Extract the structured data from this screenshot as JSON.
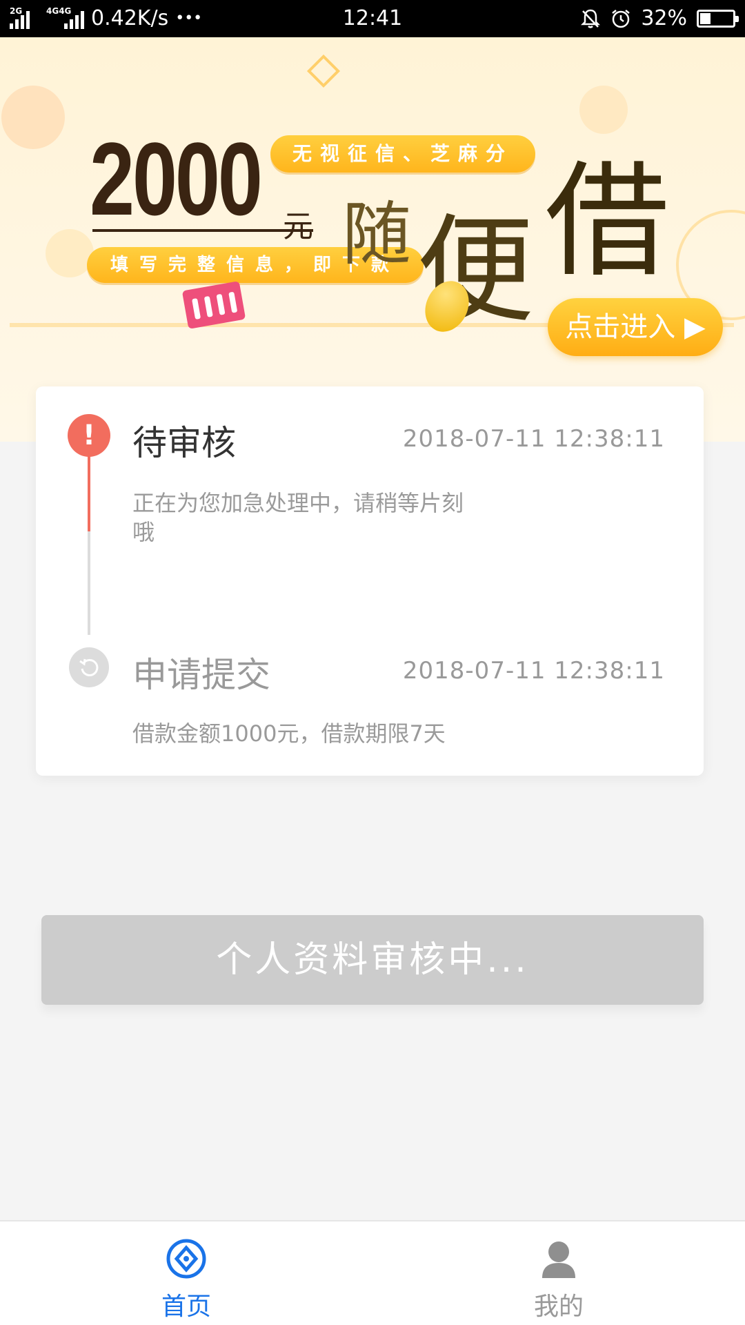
{
  "status_bar": {
    "net_tag_1": "2G",
    "net_tag_2": "4G4G",
    "speed": "0.42K/s",
    "more": "•••",
    "time": "12:41",
    "battery": "32%",
    "battery_level": 0.32,
    "icons": [
      "mute-bell-icon",
      "alarm-icon",
      "battery-icon"
    ]
  },
  "banner": {
    "amount": "2000",
    "unit": "元",
    "tag_top": "无视征信、芝麻分",
    "tag_bottom": "填写完整信息，即下款",
    "slogan_1": "随",
    "slogan_2": "便",
    "slogan_3": "借",
    "enter_label": "点击进入 ▶"
  },
  "timeline": {
    "steps": [
      {
        "title": "待审核",
        "time": "2018-07-11 12:38:11",
        "desc_line1": "正在为您加急处理中，请稍等片刻",
        "desc_line2": "哦",
        "icon": "exclamation-icon",
        "color": "#f26d5e"
      },
      {
        "title": "申请提交",
        "time": "2018-07-11 12:38:11",
        "desc_line1": "借款金额1000元，借款期限7天",
        "icon": "refresh-icon",
        "color": "#dcdcdc"
      }
    ]
  },
  "main_button": {
    "label": "个人资料审核中..."
  },
  "tab_bar": {
    "tabs": [
      {
        "label": "首页",
        "icon": "home-compass-icon",
        "active": true,
        "color": "#1a73e8"
      },
      {
        "label": "我的",
        "icon": "user-icon",
        "active": false,
        "color": "#999999"
      }
    ]
  }
}
